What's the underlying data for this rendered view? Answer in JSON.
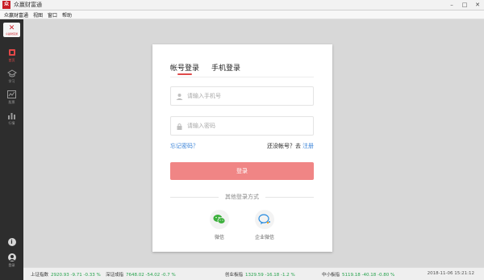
{
  "window": {
    "title": "众赢财富通",
    "logo_text": "众",
    "minimize": "–",
    "maximize": "□",
    "close": "✕"
  },
  "menu": {
    "items": [
      "众赢财富通",
      "视图",
      "窗口",
      "帮助"
    ]
  },
  "sidebar": {
    "brand_text": "众赢财富通",
    "items": [
      {
        "label": "首页",
        "icon": "home-icon",
        "active": true
      },
      {
        "label": "学习",
        "icon": "graduation-cap-icon",
        "active": false
      },
      {
        "label": "股票",
        "icon": "line-chart-icon",
        "active": false
      },
      {
        "label": "行情",
        "icon": "bar-chart-icon",
        "active": false
      }
    ],
    "info_icon": "info-icon",
    "user_label": "登录"
  },
  "login": {
    "tabs": [
      {
        "label": "帐号登录",
        "active": true
      },
      {
        "label": "手机登录",
        "active": false
      }
    ],
    "phone_placeholder": "请输入手机号",
    "password_placeholder": "请输入密码",
    "forgot": "忘记密码？",
    "no_account": "还没帐号？去",
    "register": "注册",
    "submit": "登录",
    "other_methods": "其他登录方式",
    "social": [
      {
        "label": "微信",
        "icon": "wechat-icon",
        "color": "#3bb03b"
      },
      {
        "label": "企业微信",
        "icon": "wecom-icon",
        "color": "#2b8de0"
      }
    ]
  },
  "status": {
    "tickers": [
      {
        "name": "上证指数",
        "value": "2920.93 -9.71 -0.33 %"
      },
      {
        "name": "深证成指",
        "value": "7648.02 -54.02 -0.7 %"
      },
      {
        "name": "创业板指",
        "value": "1329.59 -16.18 -1.2 %"
      },
      {
        "name": "中小板指",
        "value": "5119.18 -40.18 -0.80 %"
      }
    ],
    "time": "2018-11-06 15:21:12"
  },
  "colors": {
    "accent_red": "#e04b4b",
    "login_button": "#f08585",
    "link_blue": "#3c84d8",
    "ticker_green": "#24a24b",
    "sidebar_bg": "#2d2d2d"
  }
}
